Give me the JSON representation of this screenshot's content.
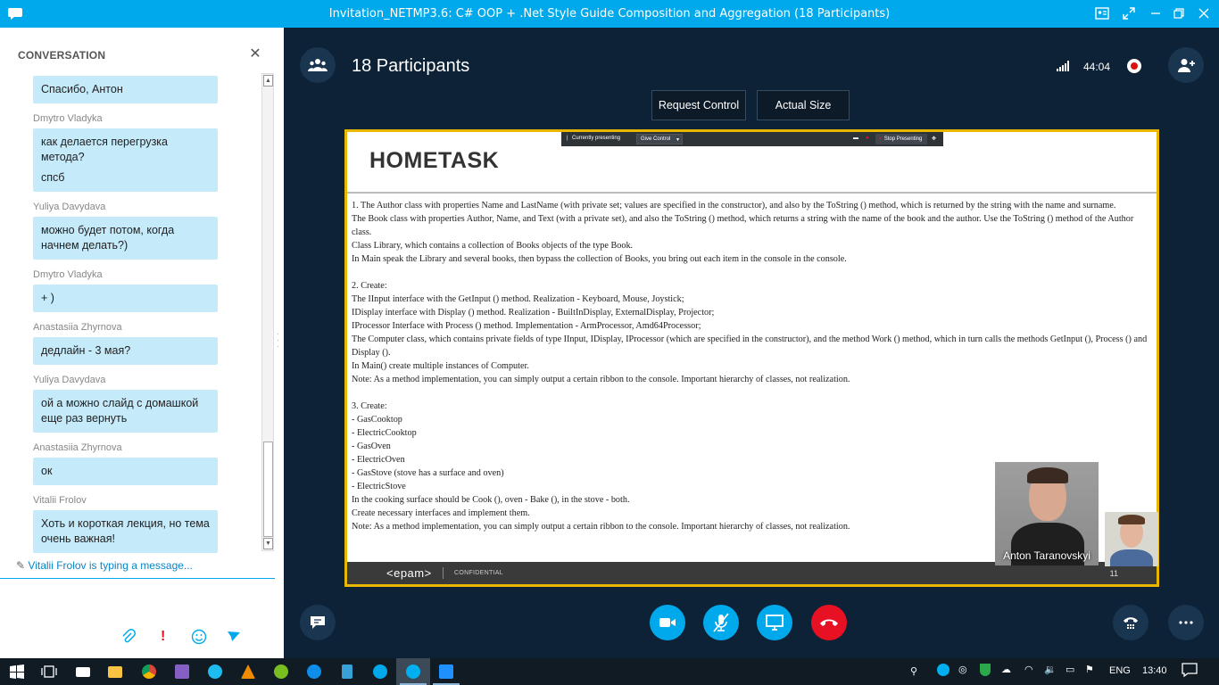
{
  "window": {
    "title": "Invitation_NETMP3.6: C# OOP + .Net Style Guide Composition and Aggregation (18 Participants)"
  },
  "conversation": {
    "header": "CONVERSATION",
    "messages": [
      {
        "sender": "",
        "lines": [
          "Спасибо, Антон"
        ]
      },
      {
        "sender": "Dmytro Vladyka",
        "lines": [
          "как делается перегрузка метода?",
          "спсб"
        ]
      },
      {
        "sender": "Yuliya Davydava",
        "lines": [
          "можно будет потом, когда начнем делать?)"
        ]
      },
      {
        "sender": "Dmytro Vladyka",
        "lines": [
          "+ )"
        ]
      },
      {
        "sender": "Anastasiia Zhyrnova",
        "lines": [
          "дедлайн - 3 мая?"
        ]
      },
      {
        "sender": "Yuliya Davydava",
        "lines": [
          "ой а можно слайд с домашкой еще раз вернуть"
        ]
      },
      {
        "sender": "Anastasiia Zhyrnova",
        "lines": [
          "ок"
        ]
      },
      {
        "sender": "Vitalii Frolov",
        "lines": [
          "Хоть и короткая лекция, но тема очень важная!"
        ]
      }
    ],
    "typing_status": "Vitalii Frolov is typing a message..."
  },
  "call": {
    "participants_label": "18 Participants",
    "timer": "44:04",
    "request_control_label": "Request Control",
    "actual_size_label": "Actual Size"
  },
  "presenting_bar": {
    "currently_presenting": "Currently presenting",
    "give_control": "Give Control",
    "stop_presenting": "Stop Presenting"
  },
  "slide": {
    "title": "HOMETASK",
    "paragraphs": [
      "1. The Author class with properties Name and LastName (with private set; values are specified in the constructor), and also by the ToString () method, which is returned by the string with the name and surname.",
      "The Book class with properties Author, Name, and Text (with a private set), and also the ToString () method, which returns a string with the name of the book and the author. Use the ToString () method of the Author class.",
      "Class Library, which contains a collection of Books objects of the type Book.",
      "In Main speak the Library and several books, then bypass the collection of Books, you bring out each item in the console in the console.",
      "",
      "2. Create:",
      "The IInput interface with the GetInput () method. Realization - Keyboard, Mouse, Joystick;",
      "IDisplay interface with Display () method. Realization - BuiltInDisplay, ExternalDisplay, Projector;",
      "IProcessor Interface with Process () method. Implementation - ArmProcessor, Amd64Processor;",
      "The Computer class, which contains private fields of type IInput, IDisplay, IProcessor (which are specified in the constructor), and the method Work () method, which in turn calls the methods GetInput (), Process () and Display ().",
      "In Main() create multiple instances of Computer.",
      "Note: As a method implementation, you can simply output a certain ribbon to the console. Important hierarchy of classes, not realization.",
      "",
      "3. Create:",
      "- GasCooktop",
      "- ElectricCooktop",
      "- GasOven",
      "- ElectricOven",
      "- GasStove (stove has a surface and oven)",
      "- ElectricStove",
      "In the cooking surface should be Cook (), oven - Bake (), in the stove - both.",
      "Create necessary interfaces and implement them.",
      "Note: As a method implementation, you can simply output a certain ribbon to the console. Important hierarchy of classes, not realization."
    ],
    "footer_logo": "<epam>",
    "footer_confidential": "CONFIDENTIAL",
    "page_number": "11"
  },
  "video": {
    "presenter_name": "Anton Taranovskyi"
  },
  "taskbar": {
    "language": "ENG",
    "clock": "13:40"
  },
  "colors": {
    "skype_blue": "#00a9ec",
    "call_bg": "#0d2236",
    "bubble": "#c5eafa",
    "end_call": "#e81123",
    "screen_border": "#e8b700"
  }
}
